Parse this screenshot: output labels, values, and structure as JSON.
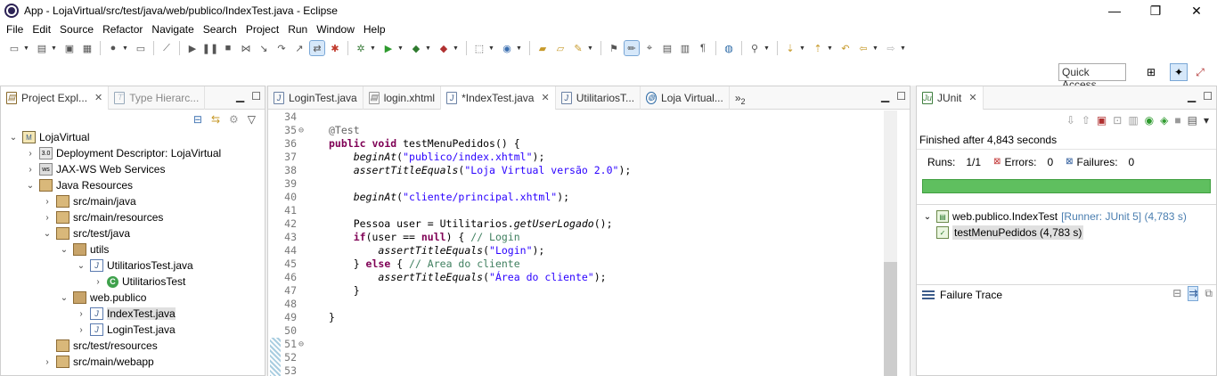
{
  "window": {
    "title": "App - LojaVirtual/src/test/java/web/publico/IndexTest.java - Eclipse",
    "minimize": "—",
    "restore": "❐",
    "close": "✕"
  },
  "menu": [
    "File",
    "Edit",
    "Source",
    "Refactor",
    "Navigate",
    "Search",
    "Project",
    "Run",
    "Window",
    "Help"
  ],
  "quick_access": {
    "placeholder": "Quick Access"
  },
  "project_explorer": {
    "tabs": [
      {
        "label": "Project Expl...",
        "close": "✕"
      },
      {
        "label": "Type Hierarc..."
      }
    ],
    "tree": [
      {
        "indent": 0,
        "twisty": "⌄",
        "icon": "proj",
        "label": "LojaVirtual"
      },
      {
        "indent": 1,
        "twisty": "›",
        "icon": "dd",
        "label": "Deployment Descriptor: LojaVirtual"
      },
      {
        "indent": 1,
        "twisty": "›",
        "icon": "ws",
        "label": "JAX-WS Web Services"
      },
      {
        "indent": 1,
        "twisty": "⌄",
        "icon": "jres",
        "label": "Java Resources"
      },
      {
        "indent": 2,
        "twisty": "›",
        "icon": "src",
        "label": "src/main/java"
      },
      {
        "indent": 2,
        "twisty": "›",
        "icon": "src",
        "label": "src/main/resources"
      },
      {
        "indent": 2,
        "twisty": "⌄",
        "icon": "src",
        "label": "src/test/java"
      },
      {
        "indent": 3,
        "twisty": "⌄",
        "icon": "pkg",
        "label": "utils"
      },
      {
        "indent": 4,
        "twisty": "⌄",
        "icon": "java",
        "label": "UtilitariosTest.java"
      },
      {
        "indent": 5,
        "twisty": "›",
        "icon": "class",
        "label": "UtilitariosTest"
      },
      {
        "indent": 3,
        "twisty": "⌄",
        "icon": "pkg",
        "label": "web.publico"
      },
      {
        "indent": 4,
        "twisty": "›",
        "icon": "java",
        "label": "IndexTest.java",
        "selected": true
      },
      {
        "indent": 4,
        "twisty": "›",
        "icon": "java",
        "label": "LoginTest.java"
      },
      {
        "indent": 2,
        "twisty": "",
        "icon": "src",
        "label": "src/test/resources"
      },
      {
        "indent": 2,
        "twisty": "›",
        "icon": "src",
        "label": "src/main/webapp"
      }
    ]
  },
  "editor": {
    "tabs": [
      {
        "label": "LoginTest.java"
      },
      {
        "label": "login.xhtml"
      },
      {
        "label": "*IndexTest.java",
        "active": true,
        "close": "✕"
      },
      {
        "label": "UtilitariosT..."
      },
      {
        "label": "Loja Virtual..."
      }
    ],
    "overflow": "»",
    "overflow_count": "2",
    "lines": [
      {
        "n": "34",
        "fold": "",
        "html": ""
      },
      {
        "n": "35",
        "fold": "⊖",
        "html": "<span class=\"ann\">@Test</span>"
      },
      {
        "n": "36",
        "fold": "",
        "html": "<span class=\"kw\">public</span> <span class=\"kw\">void</span> testMenuPedidos() {"
      },
      {
        "n": "37",
        "fold": "",
        "html": "    <span class=\"it\">beginAt</span>(<span class=\"str\">\"publico/index.xhtml\"</span>);"
      },
      {
        "n": "38",
        "fold": "",
        "html": "    <span class=\"it\">assertTitleEquals</span>(<span class=\"str\">\"Loja Virtual versão 2.0\"</span>);"
      },
      {
        "n": "39",
        "fold": "",
        "html": ""
      },
      {
        "n": "40",
        "fold": "",
        "html": "    <span class=\"it\">beginAt</span>(<span class=\"str\">\"cliente/principal.xhtml\"</span>);"
      },
      {
        "n": "41",
        "fold": "",
        "html": ""
      },
      {
        "n": "42",
        "fold": "",
        "html": "    Pessoa user = Utilitarios.<span class=\"it\">getUserLogado</span>();"
      },
      {
        "n": "43",
        "fold": "",
        "html": "    <span class=\"kw\">if</span>(user == <span class=\"kw\">null</span>) { <span class=\"cm\">// Login</span>"
      },
      {
        "n": "44",
        "fold": "",
        "html": "        <span class=\"it\">assertTitleEquals</span>(<span class=\"str\">\"Login\"</span>);"
      },
      {
        "n": "45",
        "fold": "",
        "html": "    } <span class=\"kw\">else</span> { <span class=\"cm\">// Area do cliente</span>"
      },
      {
        "n": "46",
        "fold": "",
        "html": "        <span class=\"it\">assertTitleEquals</span>(<span class=\"str\">\"Área do cliente\"</span>);"
      },
      {
        "n": "47",
        "fold": "",
        "html": "    }"
      },
      {
        "n": "48",
        "fold": "",
        "html": ""
      },
      {
        "n": "49",
        "fold": "",
        "html": "}"
      },
      {
        "n": "50",
        "fold": "",
        "html": ""
      },
      {
        "n": "51",
        "fold": "⊖",
        "html": ""
      },
      {
        "n": "52",
        "fold": "",
        "html": ""
      },
      {
        "n": "53",
        "fold": "",
        "html": ""
      }
    ]
  },
  "junit": {
    "tab_label": "JUnit",
    "tab_close": "✕",
    "status": "Finished after 4,843 seconds",
    "runs_label": "Runs:",
    "runs_value": "1/1",
    "errors_label": "Errors:",
    "errors_value": "0",
    "failures_label": "Failures:",
    "failures_value": "0",
    "progress": 1.0,
    "progress_color": "#5fbf5f",
    "suite": {
      "name": "web.publico.IndexTest",
      "runner": "[Runner: JUnit 5] (4,783 s)"
    },
    "test": {
      "name": "testMenuPedidos (4,783 s)"
    },
    "failure_trace_label": "Failure Trace"
  }
}
